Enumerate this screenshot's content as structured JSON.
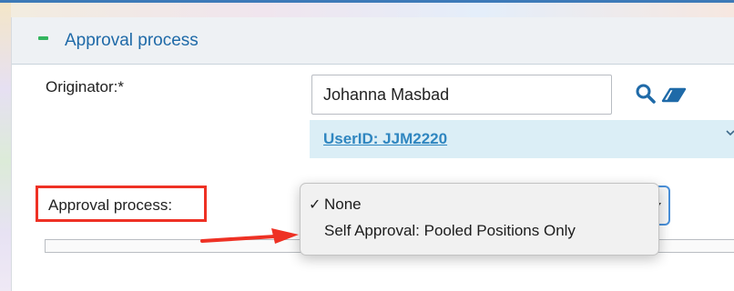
{
  "section": {
    "title": "Approval process",
    "collapse_icon": "minus-icon",
    "accent_color": "#1f6aa8"
  },
  "originator": {
    "label": "Originator:*",
    "value": "Johanna Masbad",
    "user_id_link": "UserID: JJM2220",
    "icons": [
      "search-icon",
      "eraser-icon",
      "chevron-down-icon"
    ]
  },
  "approval": {
    "label": "Approval process:",
    "highlight_color": "#ee3124",
    "dropdown": {
      "options": [
        {
          "check": "✓",
          "label": "None",
          "selected": true
        },
        {
          "check": "",
          "label": "Self Approval: Pooled Positions Only",
          "selected": false
        }
      ]
    }
  },
  "annotation": {
    "arrow_color": "#ee3124"
  }
}
